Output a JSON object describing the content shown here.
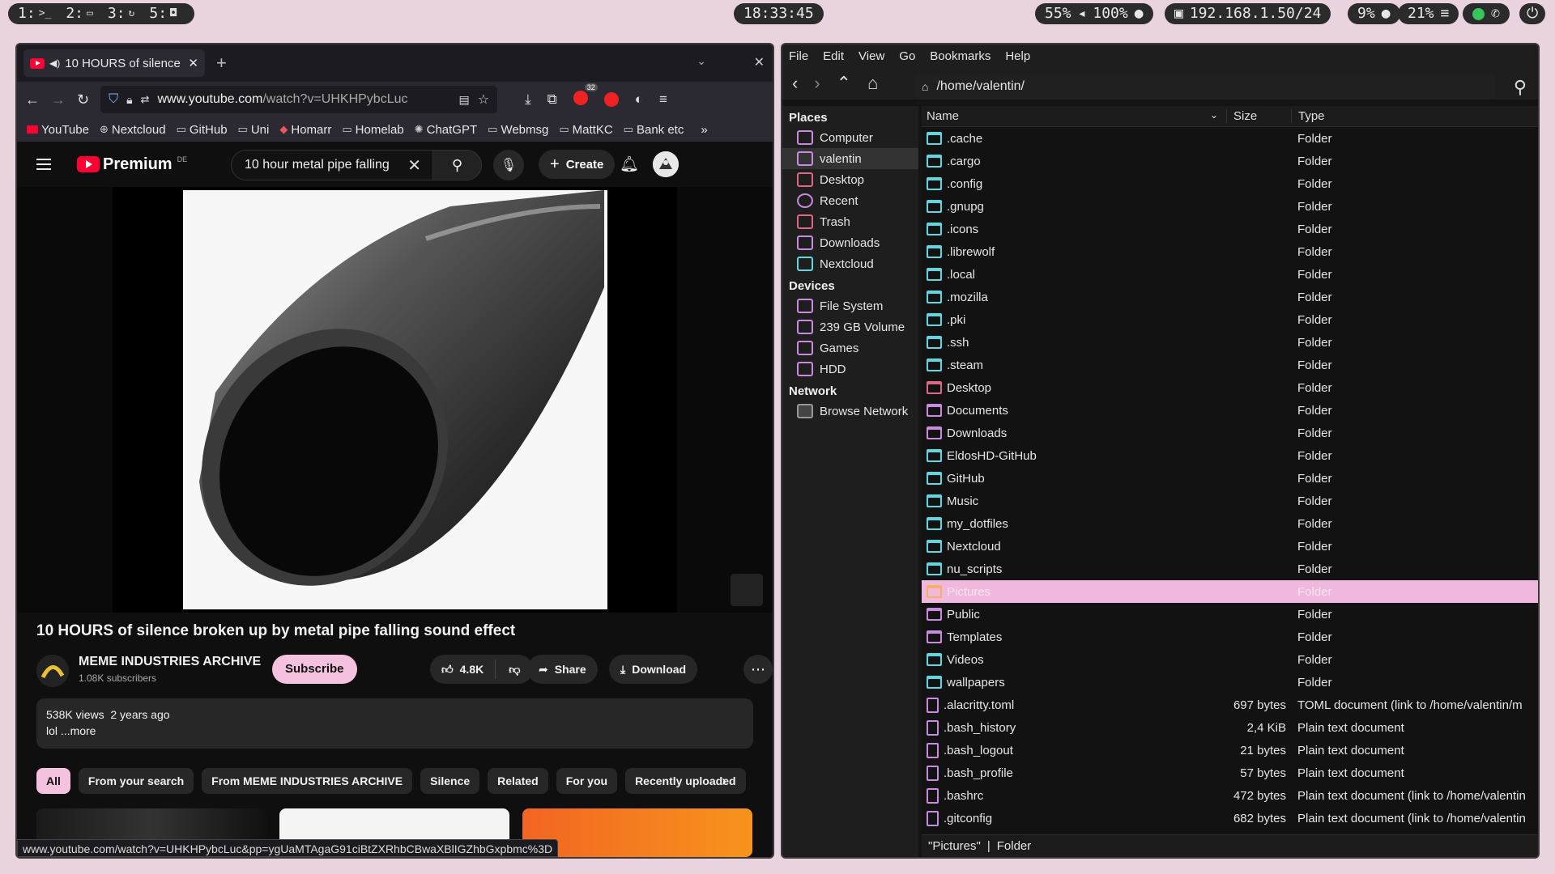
{
  "topbar": {
    "workspaces": [
      {
        "num": "1:",
        "icon": ">_"
      },
      {
        "num": "2:",
        "icon": "▭"
      },
      {
        "num": "3:",
        "icon": "↻"
      },
      {
        "num": "5:",
        "icon": "◘"
      }
    ],
    "clock": "18:33:45",
    "brightness": "55%",
    "volume": "100%",
    "network": "192.168.1.50/24",
    "cpu": "9%",
    "memory": "21%"
  },
  "browser": {
    "tab_title": "10 HOURS of silence",
    "url_prefix": "www.youtube.com",
    "url_rest": "/watch?v=UHKHPybcLuc",
    "extension_badge": "32",
    "bookmarks": [
      "YouTube",
      "Nextcloud",
      "GitHub",
      "Uni",
      "Homarr",
      "Homelab",
      "ChatGPT",
      "Webmsg",
      "MattKC",
      "Bank etc"
    ],
    "status_url": "www.youtube.com/watch?v=UHKHPybcLuc&pp=ygUaMTAgaG91ciBtZXRhbCBwaXBlIGZhbGxpbmc%3D"
  },
  "youtube": {
    "logo_text": "Premium",
    "region": "DE",
    "search_value": "10 hour metal pipe falling",
    "create_label": "Create",
    "video_title": "10 HOURS of silence broken up by metal pipe falling sound effect",
    "channel_name": "MEME INDUSTRIES ARCHIVE",
    "subscribers": "1.08K subscribers",
    "subscribe_label": "Subscribe",
    "likes": "4.8K",
    "share_label": "Share",
    "download_label": "Download",
    "views_line": "538K views  2 years ago",
    "description": "lol ...more",
    "chips": [
      "All",
      "From your search",
      "From MEME INDUSTRIES ARCHIVE",
      "Silence",
      "Related",
      "For you",
      "Recently uploaded"
    ]
  },
  "filemanager": {
    "menu": [
      "File",
      "Edit",
      "View",
      "Go",
      "Bookmarks",
      "Help"
    ],
    "path": "/home/valentin/",
    "sidebar": {
      "places_heading": "Places",
      "places": [
        "Computer",
        "valentin",
        "Desktop",
        "Recent",
        "Trash",
        "Downloads",
        "Nextcloud"
      ],
      "devices_heading": "Devices",
      "devices": [
        "File System",
        "239 GB Volume",
        "Games",
        "HDD"
      ],
      "network_heading": "Network",
      "network": [
        "Browse Network"
      ]
    },
    "columns": {
      "name": "Name",
      "size": "Size",
      "type": "Type"
    },
    "files": [
      {
        "name": ".cache",
        "size": "",
        "type": "Folder",
        "icon": "folder"
      },
      {
        "name": ".cargo",
        "size": "",
        "type": "Folder",
        "icon": "folder"
      },
      {
        "name": ".config",
        "size": "",
        "type": "Folder",
        "icon": "folder"
      },
      {
        "name": ".gnupg",
        "size": "",
        "type": "Folder",
        "icon": "folder"
      },
      {
        "name": ".icons",
        "size": "",
        "type": "Folder",
        "icon": "folder"
      },
      {
        "name": ".librewolf",
        "size": "",
        "type": "Folder",
        "icon": "folder"
      },
      {
        "name": ".local",
        "size": "",
        "type": "Folder",
        "icon": "folder"
      },
      {
        "name": ".mozilla",
        "size": "",
        "type": "Folder",
        "icon": "folder"
      },
      {
        "name": ".pki",
        "size": "",
        "type": "Folder",
        "icon": "folder"
      },
      {
        "name": ".ssh",
        "size": "",
        "type": "Folder",
        "icon": "folder"
      },
      {
        "name": ".steam",
        "size": "",
        "type": "Folder",
        "icon": "folder"
      },
      {
        "name": "Desktop",
        "size": "",
        "type": "Folder",
        "icon": "pink"
      },
      {
        "name": "Documents",
        "size": "",
        "type": "Folder",
        "icon": "purple"
      },
      {
        "name": "Downloads",
        "size": "",
        "type": "Folder",
        "icon": "purple"
      },
      {
        "name": "EldosHD-GitHub",
        "size": "",
        "type": "Folder",
        "icon": "folder"
      },
      {
        "name": "GitHub",
        "size": "",
        "type": "Folder",
        "icon": "folder"
      },
      {
        "name": "Music",
        "size": "",
        "type": "Folder",
        "icon": "folder"
      },
      {
        "name": "my_dotfiles",
        "size": "",
        "type": "Folder",
        "icon": "folder"
      },
      {
        "name": "Nextcloud",
        "size": "",
        "type": "Folder",
        "icon": "folder"
      },
      {
        "name": "nu_scripts",
        "size": "",
        "type": "Folder",
        "icon": "folder"
      },
      {
        "name": "Pictures",
        "size": "",
        "type": "Folder",
        "icon": "orange",
        "selected": true
      },
      {
        "name": "Public",
        "size": "",
        "type": "Folder",
        "icon": "purple"
      },
      {
        "name": "Templates",
        "size": "",
        "type": "Folder",
        "icon": "purple"
      },
      {
        "name": "Videos",
        "size": "",
        "type": "Folder",
        "icon": "folder"
      },
      {
        "name": "wallpapers",
        "size": "",
        "type": "Folder",
        "icon": "folder"
      },
      {
        "name": ".alacritty.toml",
        "size": "697 bytes",
        "type": "TOML document (link to /home/valentin/m",
        "icon": "doc"
      },
      {
        "name": ".bash_history",
        "size": "2,4 KiB",
        "type": "Plain text document",
        "icon": "doc"
      },
      {
        "name": ".bash_logout",
        "size": "21 bytes",
        "type": "Plain text document",
        "icon": "doc"
      },
      {
        "name": ".bash_profile",
        "size": "57 bytes",
        "type": "Plain text document",
        "icon": "doc"
      },
      {
        "name": ".bashrc",
        "size": "472 bytes",
        "type": "Plain text document (link to /home/valentin",
        "icon": "doc"
      },
      {
        "name": ".gitconfig",
        "size": "682 bytes",
        "type": "Plain text document (link to /home/valentin",
        "icon": "doc"
      }
    ],
    "status_name": "\"Pictures\"",
    "status_type": "Folder"
  }
}
